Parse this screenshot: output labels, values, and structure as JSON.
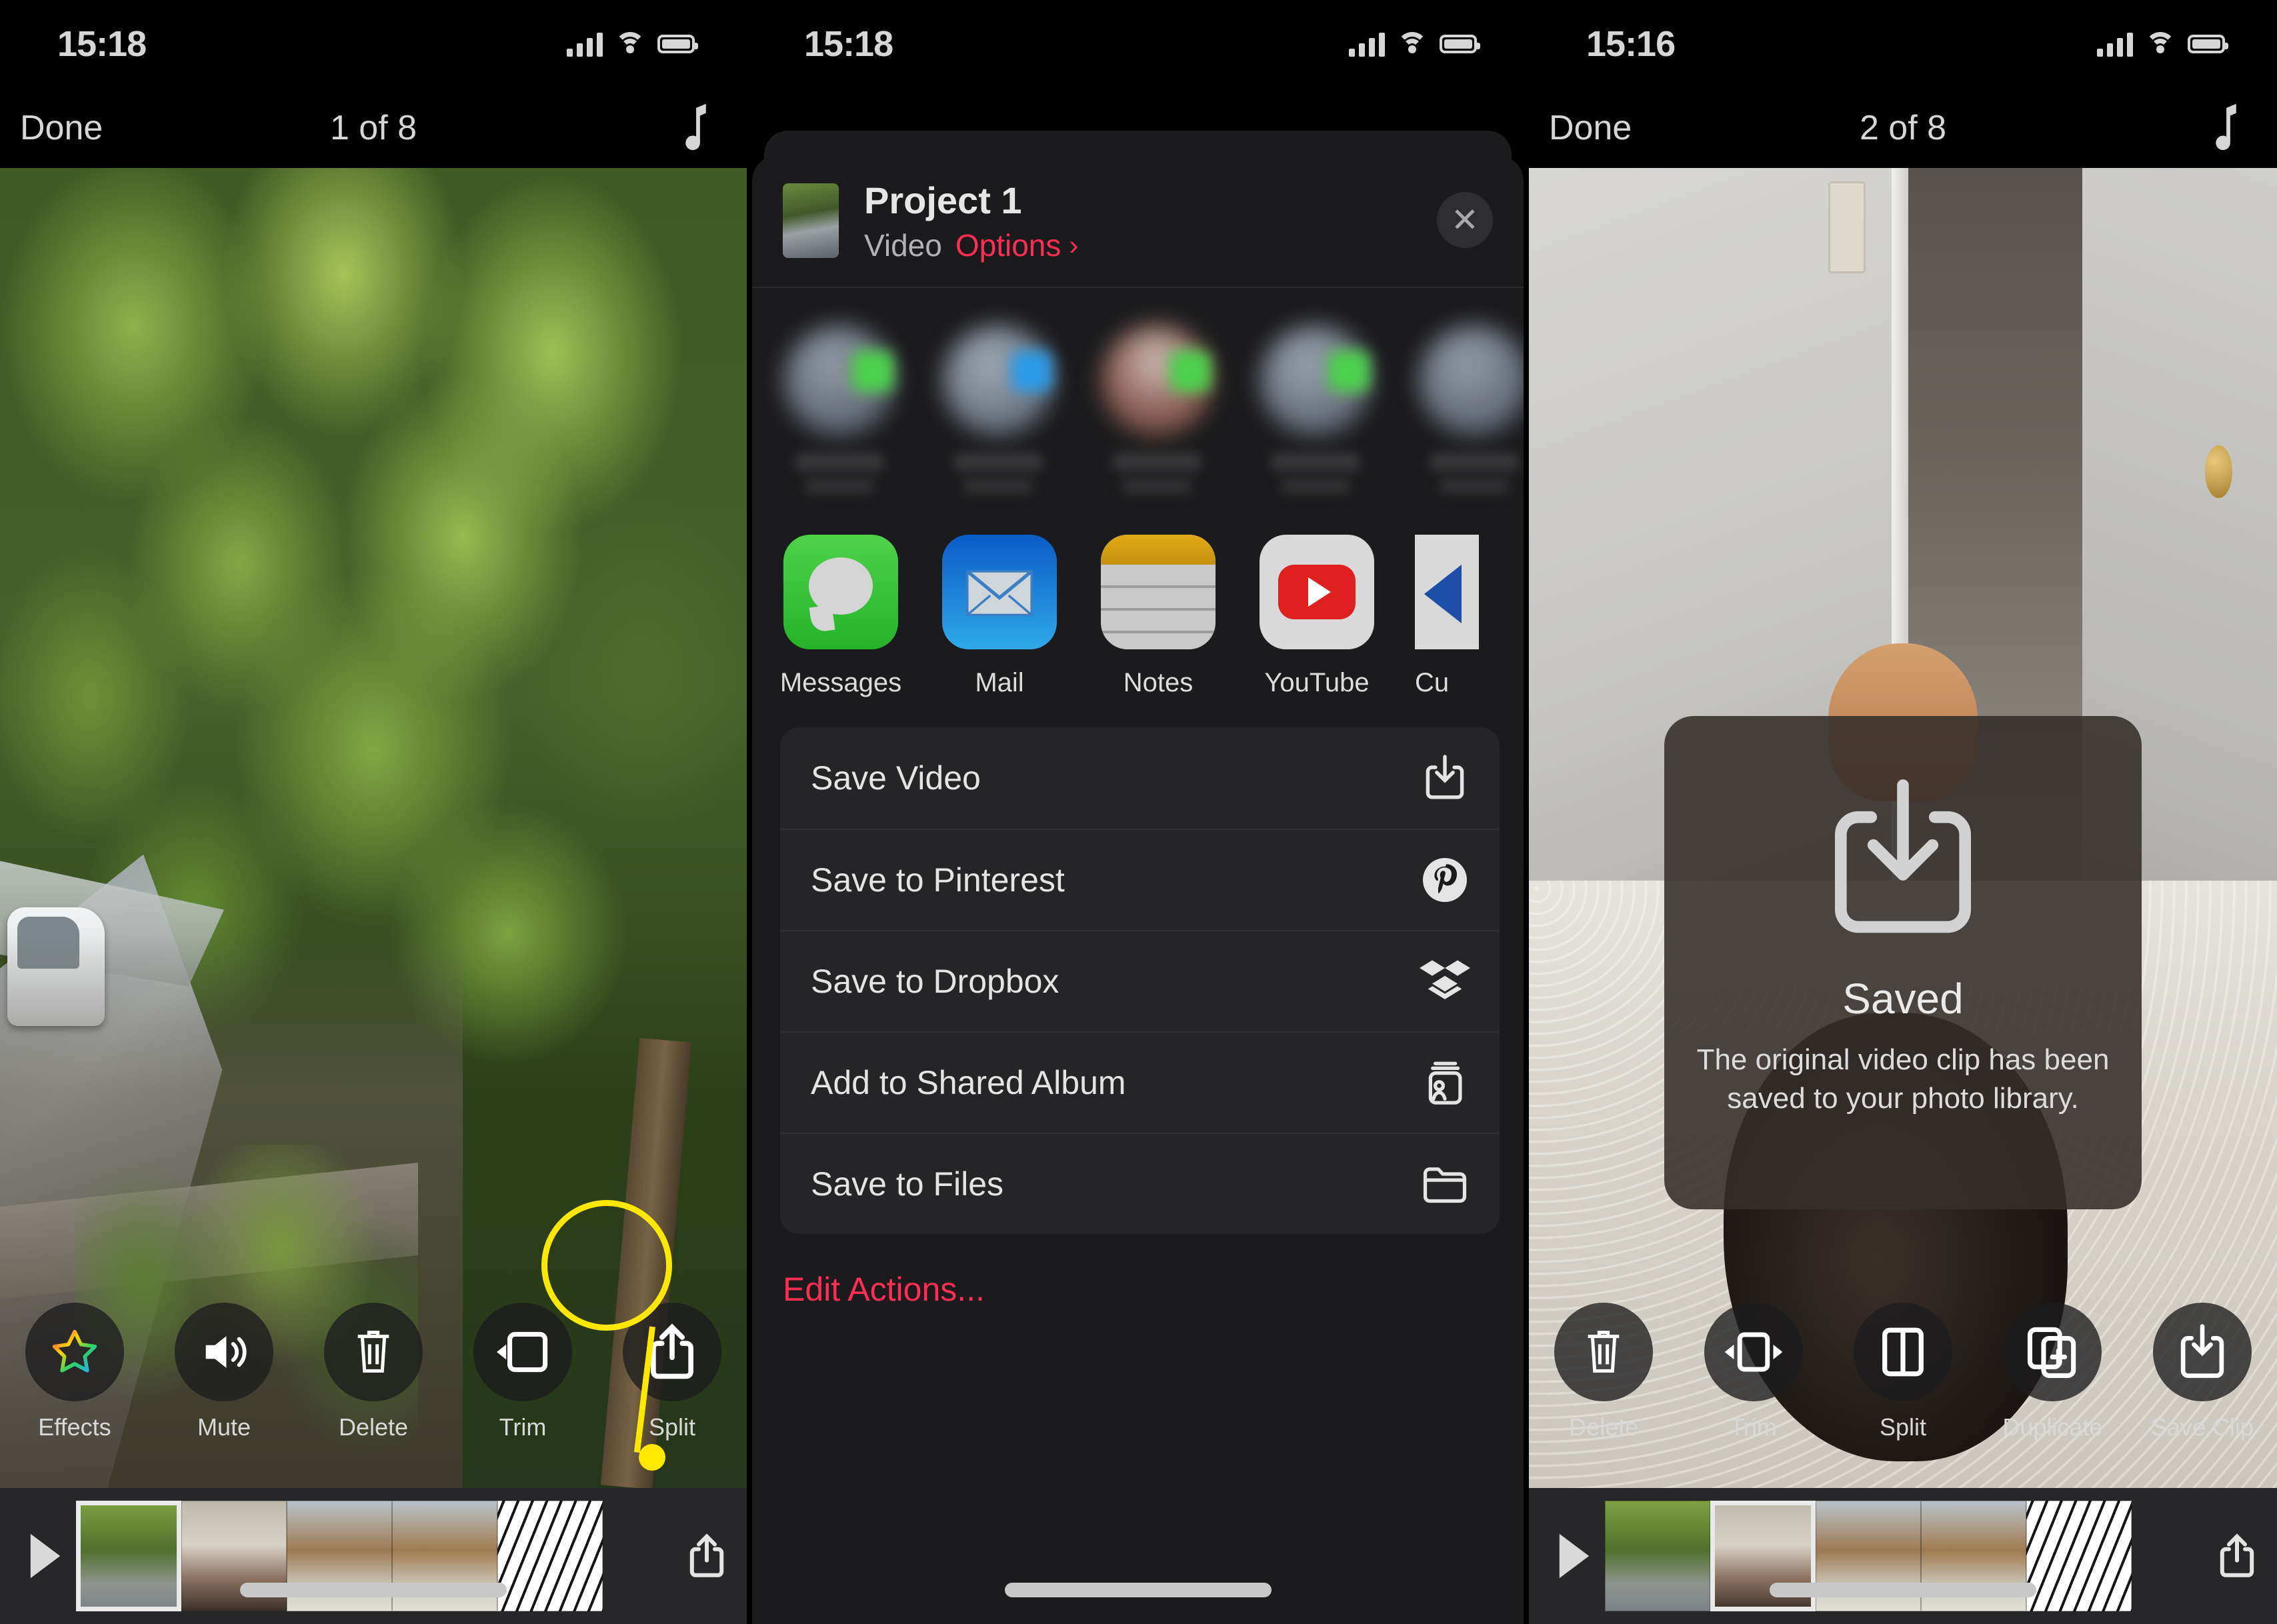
{
  "panel1": {
    "status": {
      "time": "15:18"
    },
    "nav": {
      "done": "Done",
      "title": "1 of 8",
      "music_icon": "music-note-icon"
    },
    "tools": [
      {
        "label": "Effects",
        "icon": "star-effects-icon"
      },
      {
        "label": "Mute",
        "icon": "speaker-icon"
      },
      {
        "label": "Delete",
        "icon": "trash-icon"
      },
      {
        "label": "Trim",
        "icon": "trim-icon"
      },
      {
        "label": "Split",
        "icon": "share-icon"
      }
    ],
    "timeline": {
      "play_icon": "play-icon",
      "share_icon": "share-icon",
      "frames": 5
    },
    "callout": {
      "color": "#ffe800",
      "target": "share-button"
    }
  },
  "panel2": {
    "status": {
      "time": "15:18"
    },
    "sheet": {
      "title": "Project 1",
      "kind": "Video",
      "options": "Options",
      "chevron": "›",
      "close_icon": "close-icon",
      "contacts": [
        {
          "badge": "green"
        },
        {
          "badge": "blue"
        },
        {
          "badge": "green"
        },
        {
          "badge": "green"
        },
        {
          "badge": "none"
        }
      ],
      "apps": [
        {
          "name": "Messages",
          "icon": "messages-icon"
        },
        {
          "name": "Mail",
          "icon": "mail-icon"
        },
        {
          "name": "Notes",
          "icon": "notes-icon"
        },
        {
          "name": "YouTube",
          "icon": "youtube-icon"
        },
        {
          "name": "Cu",
          "icon": "cut-app-icon"
        }
      ],
      "actions": [
        {
          "label": "Save Video",
          "icon": "save-download-icon"
        },
        {
          "label": "Save to Pinterest",
          "icon": "pinterest-icon"
        },
        {
          "label": "Save to Dropbox",
          "icon": "dropbox-icon"
        },
        {
          "label": "Add to Shared Album",
          "icon": "shared-album-icon"
        },
        {
          "label": "Save to Files",
          "icon": "folder-icon"
        }
      ],
      "edit_actions": "Edit Actions...",
      "accent_color": "#ff2d55"
    }
  },
  "panel3": {
    "status": {
      "time": "15:16"
    },
    "nav": {
      "done": "Done",
      "title": "2 of 8",
      "music_icon": "music-note-icon"
    },
    "toast": {
      "icon": "save-download-icon",
      "title": "Saved",
      "message": "The original video clip has been saved to your photo library."
    },
    "tools": [
      {
        "label": "Delete",
        "icon": "trash-icon"
      },
      {
        "label": "Trim",
        "icon": "trim-icon"
      },
      {
        "label": "Split",
        "icon": "split-icon"
      },
      {
        "label": "Duplicate",
        "icon": "duplicate-icon"
      },
      {
        "label": "Save Clip",
        "icon": "save-download-icon"
      }
    ],
    "timeline": {
      "play_icon": "play-icon",
      "share_icon": "share-icon",
      "frames": 5
    }
  }
}
